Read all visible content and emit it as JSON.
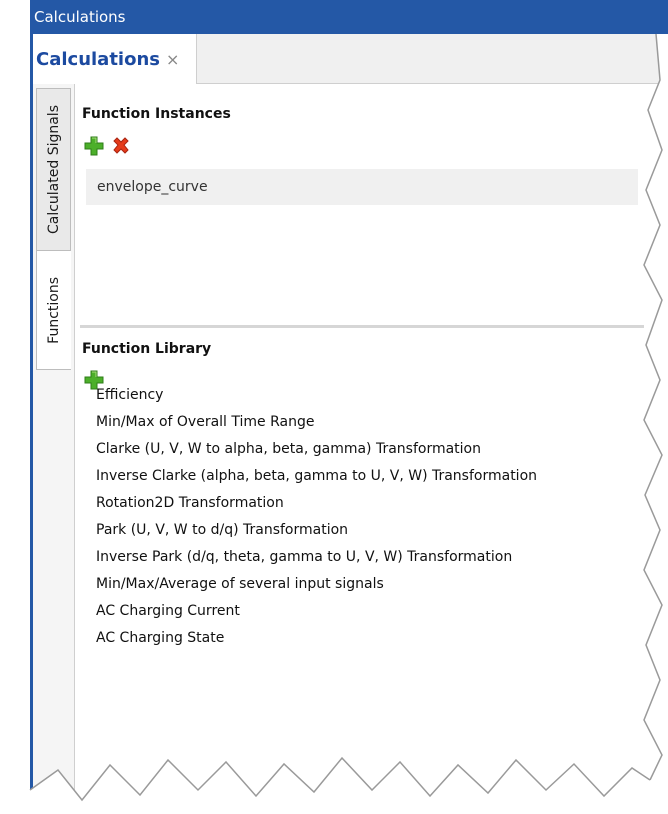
{
  "window": {
    "title": "Calculations"
  },
  "document_tab": {
    "label": "Calculations",
    "close_glyph": "×"
  },
  "side_tabs": [
    {
      "label": "Calculated Signals",
      "active": false
    },
    {
      "label": "Functions",
      "active": true
    }
  ],
  "instances": {
    "title": "Function Instances",
    "items": [
      "envelope_curve"
    ],
    "add_icon": "green-plus-icon",
    "delete_icon": "red-x-icon"
  },
  "library": {
    "title": "Function Library",
    "add_icon": "green-plus-icon",
    "items": [
      "Efficiency",
      "Min/Max of Overall Time Range",
      "Clarke (U, V, W to alpha, beta, gamma) Transformation",
      "Inverse Clarke (alpha, beta, gamma to U, V, W) Transformation",
      "Rotation2D Transformation",
      "Park (U, V, W to d/q) Transformation",
      "Inverse Park (d/q, theta, gamma to U, V, W) Transformation",
      "Min/Max/Average of several input signals",
      "AC Charging Current",
      "AC Charging State"
    ]
  },
  "colors": {
    "title_bar": "#2458a6",
    "tab_text": "#1c4aa0",
    "add_green": "#4caf2a",
    "delete_red": "#e53b1a"
  }
}
